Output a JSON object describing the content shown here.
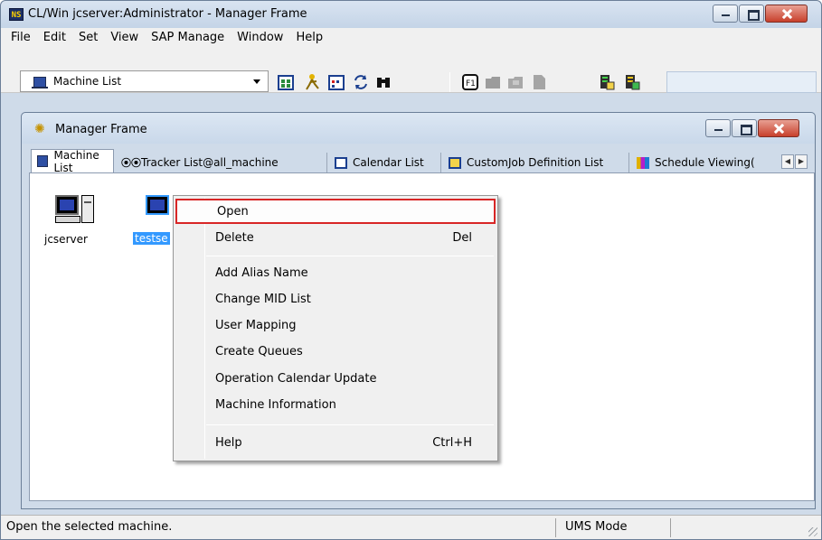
{
  "window": {
    "app_icon_text": "NS",
    "title": "CL/Win jcserver:Administrator - Manager Frame"
  },
  "menubar": {
    "items": [
      "File",
      "Edit",
      "Set",
      "View",
      "SAP Manage",
      "Window",
      "Help"
    ]
  },
  "toolbar": {
    "view_selector_value": "Machine List",
    "buttons": [
      "calendar-grid-icon",
      "tracker-figure-icon",
      "calendar-icon",
      "refresh-icon",
      "find-binoculars-icon",
      "f1-help-icon",
      "folder-icon",
      "folder-open-icon",
      "document-icon",
      "server-green-icon",
      "server-yellow-icon"
    ]
  },
  "inner_frame": {
    "title": "Manager Frame"
  },
  "tabs": [
    {
      "label": "Machine List",
      "active": true
    },
    {
      "label": "Tracker List@all_machine",
      "active": false
    },
    {
      "label": "Calendar List",
      "active": false
    },
    {
      "label": "CustomJob Definition List",
      "active": false
    },
    {
      "label": "Schedule Viewing(",
      "active": false
    }
  ],
  "machines": [
    {
      "label": "jcserver",
      "selected": false
    },
    {
      "label": "testse",
      "selected": true
    }
  ],
  "context_menu": {
    "items": [
      {
        "label": "Open",
        "shortcut": "",
        "highlighted": true
      },
      {
        "label": "Delete",
        "shortcut": "Del"
      },
      {
        "label": "Add Alias Name",
        "shortcut": ""
      },
      {
        "label": "Change MID List",
        "shortcut": ""
      },
      {
        "label": "User Mapping",
        "shortcut": ""
      },
      {
        "label": "Create Queues",
        "shortcut": ""
      },
      {
        "label": "Operation Calendar Update",
        "shortcut": ""
      },
      {
        "label": "Machine Information",
        "shortcut": ""
      },
      {
        "label": "Help",
        "shortcut": "Ctrl+H"
      }
    ]
  },
  "statusbar": {
    "message": "Open the selected machine.",
    "mode": "UMS Mode"
  },
  "colors": {
    "selection": "#3399ff",
    "highlight_border": "#d82626",
    "close_button": "#c8402c"
  }
}
